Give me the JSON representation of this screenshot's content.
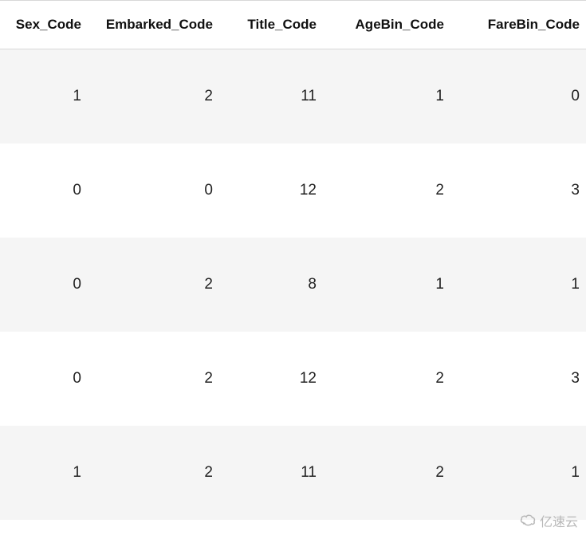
{
  "chart_data": {
    "type": "table",
    "title": "",
    "columns": [
      "Sex_Code",
      "Embarked_Code",
      "Title_Code",
      "AgeBin_Code",
      "FareBin_Code"
    ],
    "rows": [
      [
        1,
        2,
        11,
        1,
        0
      ],
      [
        0,
        0,
        12,
        2,
        3
      ],
      [
        0,
        2,
        8,
        1,
        1
      ],
      [
        0,
        2,
        12,
        2,
        3
      ],
      [
        1,
        2,
        11,
        2,
        1
      ]
    ]
  },
  "watermark": {
    "text": "亿速云"
  }
}
